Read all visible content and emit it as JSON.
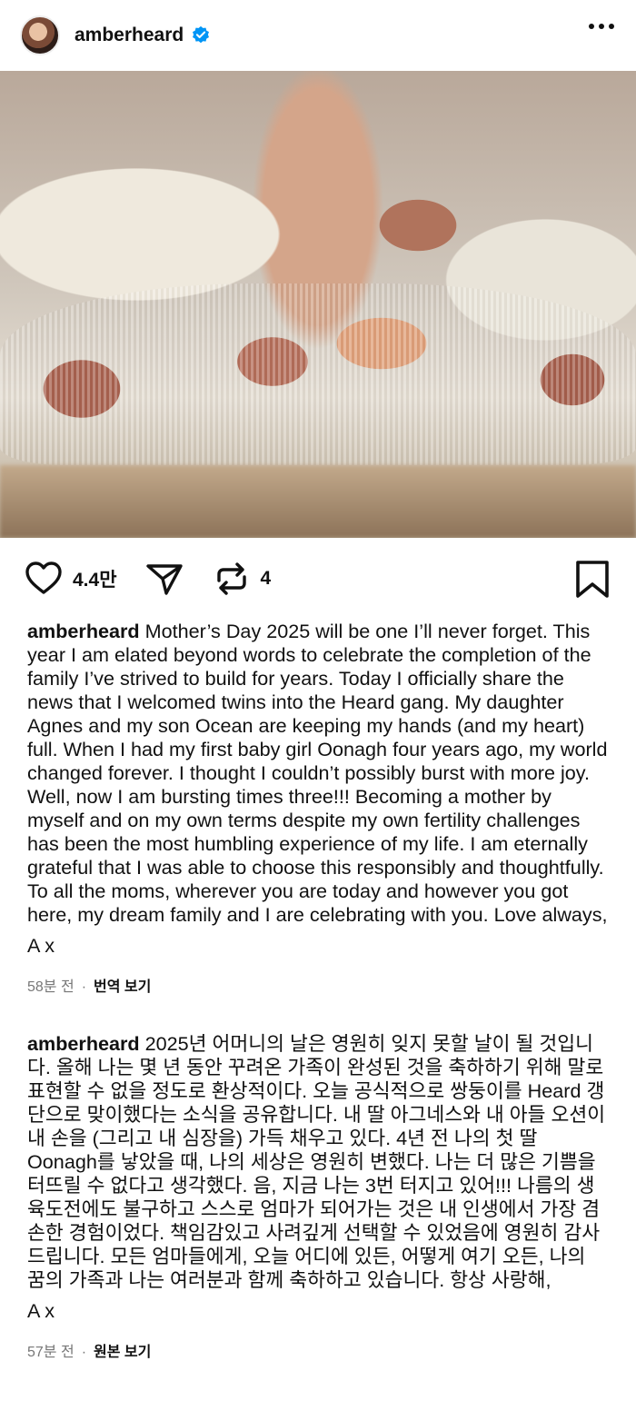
{
  "header": {
    "username": "amberheard",
    "verified_icon": "verified-badge-icon",
    "more_icon": "more-dots-icon"
  },
  "actions": {
    "like_count": "4.4만",
    "repost_count": "4",
    "icons": [
      "heart-icon",
      "send-icon",
      "repost-icon",
      "bookmark-icon"
    ]
  },
  "captions": [
    {
      "user": "amberheard",
      "text": "Mother’s Day 2025 will be one I’ll never forget. This year I am elated beyond words to celebrate the completion of the family I’ve strived to build for years. Today I officially share the news that I welcomed twins into the Heard gang. My daughter Agnes and my son Ocean are keeping my hands (and my heart) full. When I had my first baby girl Oonagh four years ago, my world changed forever. I thought I couldn’t possibly burst with more joy. Well, now I am bursting times three!!! Becoming a mother by myself and on my own terms despite my own fertility challenges has been the most humbling experience of my life. I am eternally grateful that I was able to choose this responsibly and thoughtfully. To all the moms, wherever you are today and however you got here, my dream family and I are celebrating with you. Love always,",
      "signature": "A x",
      "time": "58분 전",
      "link": "번역 보기"
    },
    {
      "user": "amberheard",
      "text": "2025년 어머니의 날은 영원히 잊지 못할 날이 될 것입니다. 올해 나는 몇 년 동안 꾸려온 가족이 완성된 것을 축하하기 위해 말로 표현할 수 없을 정도로 환상적이다. 오늘 공식적으로 쌍둥이를 Heard 갱단으로 맞이했다는 소식을 공유합니다. 내 딸 아그네스와 내 아들 오션이 내 손을 (그리고 내 심장을) 가득 채우고 있다. 4년 전 나의 첫 딸 Oonagh를 낳았을 때, 나의 세상은 영원히 변했다. 나는 더 많은 기쁨을 터뜨릴 수 없다고 생각했다. 음, 지금 나는 3번 터지고 있어!!! 나름의 생육도전에도 불구하고 스스로 엄마가 되어가는 것은 내 인생에서 가장 겸손한 경험이었다. 책임감있고 사려깊게 선택할 수 있었음에 영원히 감사드립니다. 모든 엄마들에게, 오늘 어디에 있든, 어떻게 여기 오든, 나의 꿈의 가족과 나는 여러분과 함께 축하하고 있습니다. 항상 사랑해,",
      "signature": "A x",
      "time": "57분 전",
      "link": "원본 보기"
    }
  ]
}
